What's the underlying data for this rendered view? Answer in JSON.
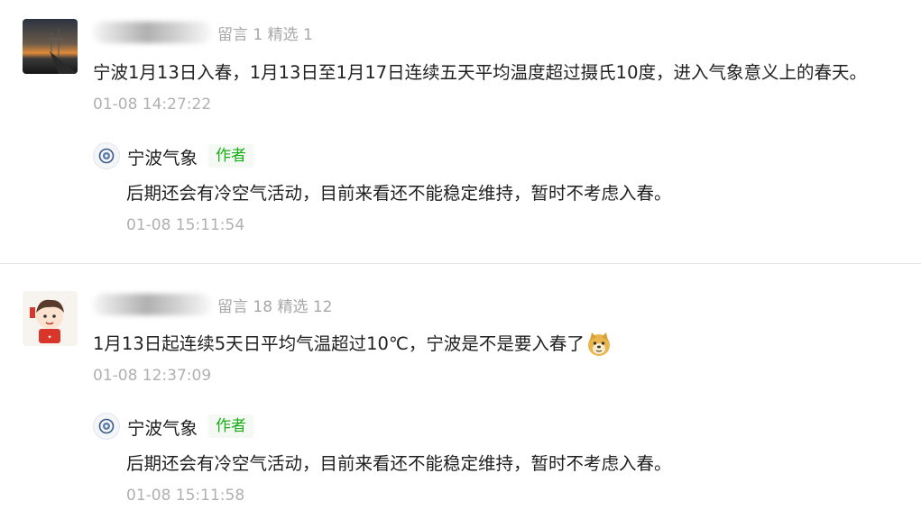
{
  "comments": [
    {
      "meta_stats": "留言 1 精选 1",
      "content": "宁波1月13日入春，1月13日至1月17日连续五天平均温度超过摄氏10度，进入气象意义上的春天。",
      "timestamp": "01-08 14:27:22",
      "avatar_icon": "sunset-photo-avatar",
      "reply": {
        "name": "宁波气象",
        "badge": "作者",
        "text": "后期还会有冷空气活动，目前来看还不能稳定维持，暂时不考虑入春。",
        "timestamp": "01-08 15:11:54"
      }
    },
    {
      "meta_stats": "留言 18 精选 12",
      "content": "1月13日起连续5天日平均气温超过10℃，宁波是不是要入春了",
      "timestamp": "01-08 12:37:09",
      "avatar_icon": "cartoon-boy-avatar",
      "emoji_icon": "doge-emoji",
      "reply": {
        "name": "宁波气象",
        "badge": "作者",
        "text": "后期还会有冷空气活动，目前来看还不能稳定维持，暂时不考虑入春。",
        "timestamp": "01-08 15:11:58"
      }
    }
  ],
  "colors": {
    "author_badge": "#1aad19",
    "muted_text": "#b0b0b0",
    "divider": "#e6e6e6"
  }
}
